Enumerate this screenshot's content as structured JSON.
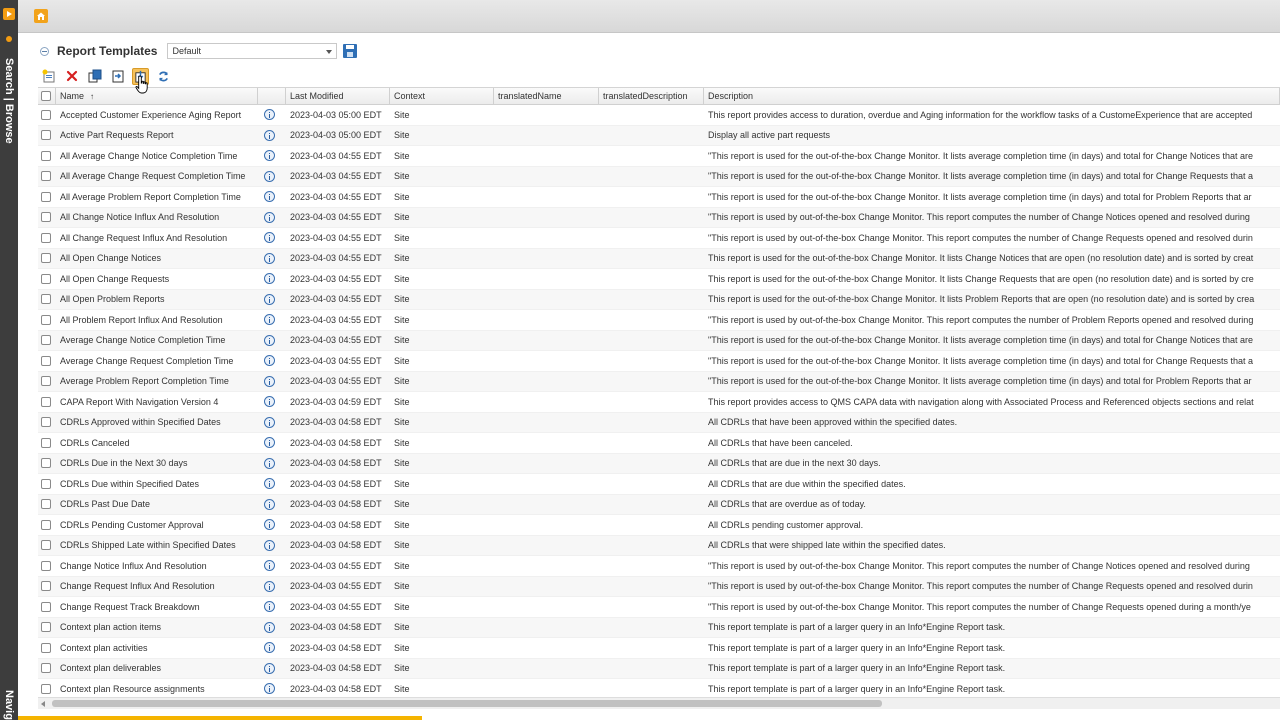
{
  "rail": {
    "search_browse": "Search | Browse",
    "navigator": "Navigator"
  },
  "panel": {
    "title": "Report Templates",
    "view": "Default"
  },
  "columns": {
    "name": "Name",
    "sort_indicator": "↑",
    "last_modified": "Last Modified",
    "context": "Context",
    "translated_name": "translatedName",
    "translated_description": "translatedDescription",
    "description": "Description"
  },
  "rows": [
    {
      "name": "Accepted Customer Experience Aging Report",
      "modified": "2023-04-03 05:00 EDT",
      "context": "Site",
      "description": "This report provides access to duration, overdue and Aging information for the workflow tasks of a CustomeExperience that are accepted"
    },
    {
      "name": "Active Part Requests Report",
      "modified": "2023-04-03 05:00 EDT",
      "context": "Site",
      "description": "Display all active part requests"
    },
    {
      "name": "All Average Change Notice Completion Time",
      "modified": "2023-04-03 04:55 EDT",
      "context": "Site",
      "description": "\"This report is used for the out-of-the-box Change Monitor.  It lists average completion time (in days) and total for Change Notices that are"
    },
    {
      "name": "All Average Change Request Completion Time",
      "modified": "2023-04-03 04:55 EDT",
      "context": "Site",
      "description": "\"This report is used for the out-of-the-box Change Monitor.  It lists average completion time (in days) and total for Change Requests that a"
    },
    {
      "name": "All Average Problem Report Completion Time",
      "modified": "2023-04-03 04:55 EDT",
      "context": "Site",
      "description": "\"This report is used for the out-of-the-box Change Monitor.  It lists average completion time (in days) and total for Problem Reports that ar"
    },
    {
      "name": "All Change Notice Influx And Resolution",
      "modified": "2023-04-03 04:55 EDT",
      "context": "Site",
      "description": "\"This report is used by out-of-the-box Change Monitor.  This report computes the number of Change Notices opened and resolved during"
    },
    {
      "name": "All Change Request Influx And Resolution",
      "modified": "2023-04-03 04:55 EDT",
      "context": "Site",
      "description": "\"This report is used by out-of-the-box Change Monitor.  This report computes the number of Change Requests opened and resolved durin"
    },
    {
      "name": "All Open Change Notices",
      "modified": "2023-04-03 04:55 EDT",
      "context": "Site",
      "description": "This report is used for the out-of-the-box Change Monitor.  It lists Change Notices that are open (no resolution date) and is sorted by creat"
    },
    {
      "name": "All Open Change Requests",
      "modified": "2023-04-03 04:55 EDT",
      "context": "Site",
      "description": "This report is used for the out-of-the-box Change Monitor.  It lists Change Requests that are open (no resolution date) and is sorted by cre"
    },
    {
      "name": "All Open Problem Reports",
      "modified": "2023-04-03 04:55 EDT",
      "context": "Site",
      "description": "This report is used for the out-of-the-box Change Monitor.  It lists Problem Reports that are open (no resolution date) and is sorted by crea"
    },
    {
      "name": "All Problem Report Influx And Resolution",
      "modified": "2023-04-03 04:55 EDT",
      "context": "Site",
      "description": "\"This report is used by out-of-the-box Change Monitor.  This report computes the number of Problem Reports opened and resolved during"
    },
    {
      "name": "Average Change Notice Completion Time",
      "modified": "2023-04-03 04:55 EDT",
      "context": "Site",
      "description": "\"This report is used for the out-of-the-box Change Monitor.  It lists average completion time (in days) and total for Change Notices that are"
    },
    {
      "name": "Average Change Request Completion Time",
      "modified": "2023-04-03 04:55 EDT",
      "context": "Site",
      "description": "\"This report is used for the out-of-the-box Change Monitor.  It lists average completion time (in days) and total for Change Requests that a"
    },
    {
      "name": "Average Problem Report Completion Time",
      "modified": "2023-04-03 04:55 EDT",
      "context": "Site",
      "description": "\"This report is used for the out-of-the-box Change Monitor.  It lists average completion time (in days) and total for Problem Reports that ar"
    },
    {
      "name": "CAPA Report With Navigation Version 4",
      "modified": "2023-04-03 04:59 EDT",
      "context": "Site",
      "description": "This report provides access to QMS CAPA data with navigation along with Associated Process and Referenced objects sections and relat"
    },
    {
      "name": "CDRLs Approved within Specified Dates",
      "modified": "2023-04-03 04:58 EDT",
      "context": "Site",
      "description": "All CDRLs that have been approved within the specified dates."
    },
    {
      "name": "CDRLs Canceled",
      "modified": "2023-04-03 04:58 EDT",
      "context": "Site",
      "description": "All CDRLs that have been canceled."
    },
    {
      "name": "CDRLs Due in the Next 30 days",
      "modified": "2023-04-03 04:58 EDT",
      "context": "Site",
      "description": "All CDRLs that are due in the next 30 days."
    },
    {
      "name": "CDRLs Due within Specified Dates",
      "modified": "2023-04-03 04:58 EDT",
      "context": "Site",
      "description": "All CDRLs that are due within the specified dates."
    },
    {
      "name": "CDRLs Past Due Date",
      "modified": "2023-04-03 04:58 EDT",
      "context": "Site",
      "description": "All CDRLs that are overdue as of today."
    },
    {
      "name": "CDRLs Pending Customer Approval",
      "modified": "2023-04-03 04:58 EDT",
      "context": "Site",
      "description": "All CDRLs pending customer approval."
    },
    {
      "name": "CDRLs Shipped Late within Specified Dates",
      "modified": "2023-04-03 04:58 EDT",
      "context": "Site",
      "description": "All CDRLs that were shipped late within the specified dates."
    },
    {
      "name": "Change Notice Influx And Resolution",
      "modified": "2023-04-03 04:55 EDT",
      "context": "Site",
      "description": "\"This report is used by out-of-the-box Change Monitor.  This report computes the number of Change Notices opened and resolved during"
    },
    {
      "name": "Change Request Influx And Resolution",
      "modified": "2023-04-03 04:55 EDT",
      "context": "Site",
      "description": "\"This report is used by out-of-the-box Change Monitor.  This report computes the number of Change Requests opened and resolved durin"
    },
    {
      "name": "Change Request Track Breakdown",
      "modified": "2023-04-03 04:55 EDT",
      "context": "Site",
      "description": "\"This report is used by out-of-the-box Change Monitor.  This report computes the number of Change Requests opened during a month/ye"
    },
    {
      "name": "Context plan action items",
      "modified": "2023-04-03 04:58 EDT",
      "context": "Site",
      "description": "This report template is part of a larger query in an Info*Engine Report task."
    },
    {
      "name": "Context plan activities",
      "modified": "2023-04-03 04:58 EDT",
      "context": "Site",
      "description": "This report template is part of a larger query in an Info*Engine Report task."
    },
    {
      "name": "Context plan deliverables",
      "modified": "2023-04-03 04:58 EDT",
      "context": "Site",
      "description": "This report template is part of a larger query in an Info*Engine Report task."
    },
    {
      "name": "Context plan Resource assignments",
      "modified": "2023-04-03 04:58 EDT",
      "context": "Site",
      "description": "This report template is part of a larger query in an Info*Engine Report task."
    }
  ]
}
